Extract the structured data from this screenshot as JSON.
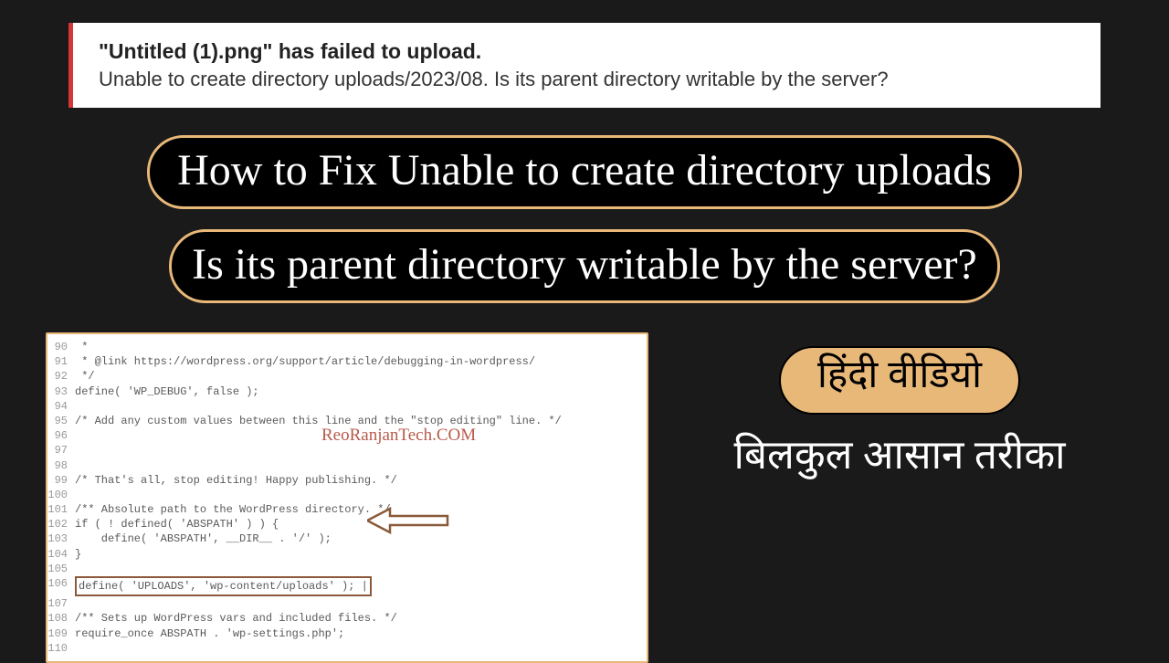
{
  "error": {
    "title": "\"Untitled (1).png\" has failed to upload.",
    "subtitle": "Unable to create directory uploads/2023/08. Is its parent directory writable by the server?"
  },
  "headings": {
    "main": "How to Fix Unable to create directory uploads",
    "sub": "Is its parent directory writable by the server?"
  },
  "code": {
    "watermark": "ReoRanjanTech.COM",
    "lines": [
      {
        "num": "90",
        "text": " *"
      },
      {
        "num": "91",
        "text": " * @link https://wordpress.org/support/article/debugging-in-wordpress/"
      },
      {
        "num": "92",
        "text": " */"
      },
      {
        "num": "93",
        "text": "define( 'WP_DEBUG', false );"
      },
      {
        "num": "94",
        "text": ""
      },
      {
        "num": "95",
        "text": "/* Add any custom values between this line and the \"stop editing\" line. */"
      },
      {
        "num": "96",
        "text": ""
      },
      {
        "num": "97",
        "text": ""
      },
      {
        "num": "98",
        "text": ""
      },
      {
        "num": "99",
        "text": "/* That's all, stop editing! Happy publishing. */"
      },
      {
        "num": "100",
        "text": ""
      },
      {
        "num": "101",
        "text": "/** Absolute path to the WordPress directory. */"
      },
      {
        "num": "102",
        "text": "if ( ! defined( 'ABSPATH' ) ) {"
      },
      {
        "num": "103",
        "text": "    define( 'ABSPATH', __DIR__ . '/' );"
      },
      {
        "num": "104",
        "text": "}"
      },
      {
        "num": "105",
        "text": ""
      },
      {
        "num": "106",
        "text": "define( 'UPLOADS', 'wp-content/uploads' ); |",
        "boxed": true
      },
      {
        "num": "107",
        "text": ""
      },
      {
        "num": "108",
        "text": "/** Sets up WordPress vars and included files. */"
      },
      {
        "num": "109",
        "text": "require_once ABSPATH . 'wp-settings.php';"
      },
      {
        "num": "110",
        "text": ""
      }
    ]
  },
  "hindi": {
    "pill": "हिंदी वीडियो",
    "subtitle": "बिलकुल आसान तरीका"
  }
}
